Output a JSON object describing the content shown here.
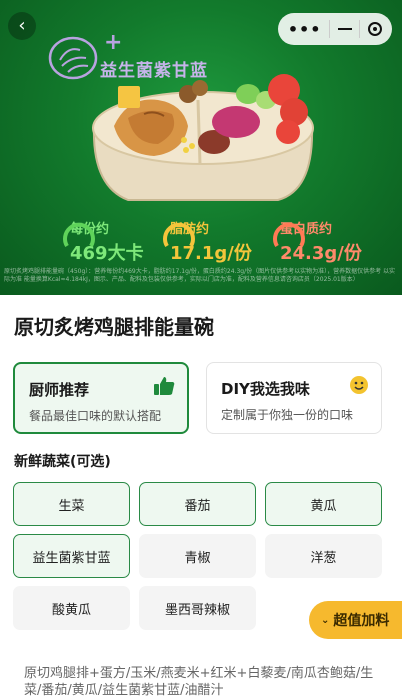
{
  "hero": {
    "brand_text": "益生菌紫甘蓝",
    "brand_plus": "+",
    "stats": [
      {
        "label": "每份约",
        "value": "469大卡"
      },
      {
        "label": "脂肪约",
        "value": "17.1g/份"
      },
      {
        "label": "蛋白质约",
        "value": "24.3g/份"
      }
    ],
    "fineprint": "原切炙烤鸡腿排能量碗（450g）：营养每份约469大卡，脂肪约17.1g/份，蛋白质约24.3g/份（图片仅供参考以实物为准），营养数据仅供参考 以实际为准 能量换算Kcal≈4.184kJ，图示、产品、配料及包装仅供参考，实际以门店为准，配料及营养信息请咨询店员（2025.01版本）"
  },
  "nav": {
    "back_icon": "back-arrow-icon",
    "more_icon": "more-dots-icon",
    "minimize_icon": "minimize-icon",
    "close_icon": "record-target-icon"
  },
  "product": {
    "title": "原切炙烤鸡腿排能量碗"
  },
  "choices": [
    {
      "title": "厨师推荐",
      "desc": "餐品最佳口味的默认搭配",
      "icon": "thumbs-up-icon",
      "selected": true
    },
    {
      "title": "DIY我选我味",
      "desc": "定制属于你独一份的口味",
      "icon": "smiley-icon",
      "selected": false
    }
  ],
  "veg_section": {
    "title": "新鲜蔬菜(可选)",
    "options": [
      {
        "label": "生菜",
        "selected": true
      },
      {
        "label": "番茄",
        "selected": true
      },
      {
        "label": "黄瓜",
        "selected": true
      },
      {
        "label": "益生菌紫甘蓝",
        "selected": true
      },
      {
        "label": "青椒",
        "selected": false
      },
      {
        "label": "洋葱",
        "selected": false
      },
      {
        "label": "酸黄瓜",
        "selected": false
      },
      {
        "label": "墨西哥辣椒",
        "selected": false
      }
    ]
  },
  "fab": {
    "label": "超值加料",
    "icon": "double-chevron-down-icon"
  },
  "ingredients": "原切鸡腿排+蛋方/玉米/燕麦米+红米+白藜麦/南瓜杏鲍菇/生菜/番茄/黄瓜/益生菌紫甘蓝/油醋汁",
  "colors": {
    "brand_green": "#1f8a3c",
    "accent_yellow": "#f6b92e",
    "hero_green": "#127a2c"
  }
}
